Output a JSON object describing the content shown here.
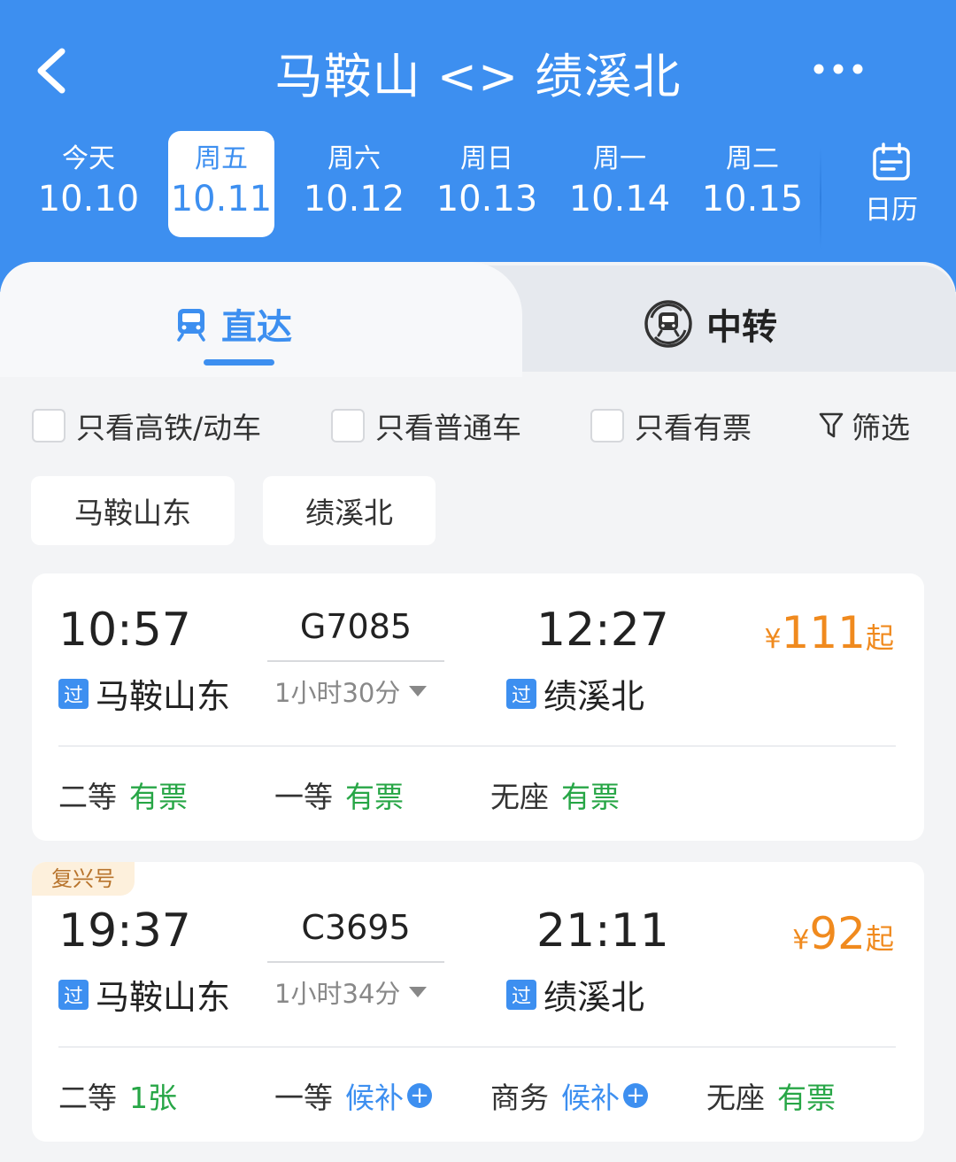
{
  "header": {
    "title": "马鞍山 <> 绩溪北",
    "calendar_label": "日历",
    "dates": [
      {
        "weekday": "今天",
        "date": "10.10",
        "selected": false
      },
      {
        "weekday": "周五",
        "date": "10.11",
        "selected": true
      },
      {
        "weekday": "周六",
        "date": "10.12",
        "selected": false
      },
      {
        "weekday": "周日",
        "date": "10.13",
        "selected": false
      },
      {
        "weekday": "周一",
        "date": "10.14",
        "selected": false
      },
      {
        "weekday": "周二",
        "date": "10.15",
        "selected": false
      }
    ]
  },
  "tabs": {
    "direct": "直达",
    "transfer": "中转",
    "active": "direct"
  },
  "filters": {
    "high_speed_only": "只看高铁/动车",
    "normal_only": "只看普通车",
    "available_only": "只看有票",
    "filter_label": "筛选"
  },
  "station_chips": [
    "马鞍山东",
    "绩溪北"
  ],
  "pass_tag": "过",
  "trains": [
    {
      "badge": "",
      "dep_time": "10:57",
      "dep_station": "马鞍山东",
      "train_no": "G7085",
      "duration": "1小时30分",
      "arr_time": "12:27",
      "arr_station": "绩溪北",
      "price_currency": "¥",
      "price": "111",
      "price_suffix": "起",
      "seats": [
        {
          "class": "二等",
          "status": "有票",
          "type": "avail"
        },
        {
          "class": "一等",
          "status": "有票",
          "type": "avail"
        },
        {
          "class": "无座",
          "status": "有票",
          "type": "avail"
        }
      ]
    },
    {
      "badge": "复兴号",
      "dep_time": "19:37",
      "dep_station": "马鞍山东",
      "train_no": "C3695",
      "duration": "1小时34分",
      "arr_time": "21:11",
      "arr_station": "绩溪北",
      "price_currency": "¥",
      "price": "92",
      "price_suffix": "起",
      "seats": [
        {
          "class": "二等",
          "status": "1张",
          "type": "avail"
        },
        {
          "class": "一等",
          "status": "候补",
          "type": "wait"
        },
        {
          "class": "商务",
          "status": "候补",
          "type": "wait"
        },
        {
          "class": "无座",
          "status": "有票",
          "type": "avail"
        }
      ]
    }
  ],
  "colors": {
    "brand_blue": "#3d8ff0",
    "price_orange": "#f08a1e",
    "available_green": "#27a646",
    "badge_bg": "#fdf0dc"
  }
}
